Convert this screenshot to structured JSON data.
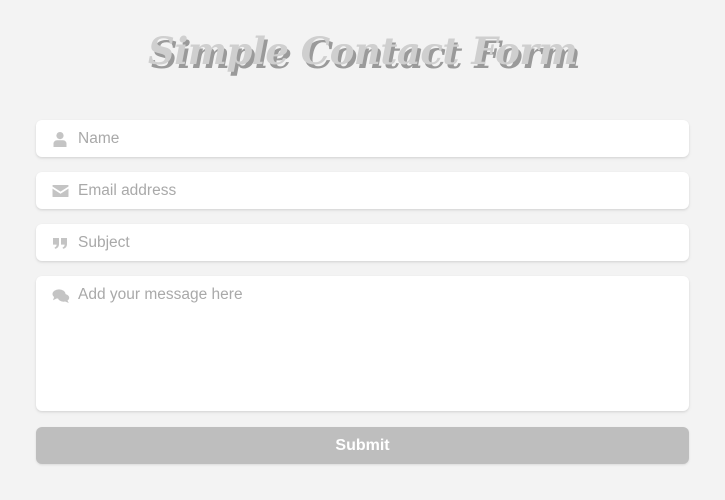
{
  "page": {
    "title": "Simple Contact Form"
  },
  "form": {
    "name": {
      "placeholder": "Name",
      "value": "",
      "icon": "user-icon"
    },
    "email": {
      "placeholder": "Email address",
      "value": "",
      "icon": "envelope-icon"
    },
    "subject": {
      "placeholder": "Subject",
      "value": "",
      "icon": "quote-icon"
    },
    "message": {
      "placeholder": "Add your message here",
      "value": "",
      "icon": "comments-icon"
    },
    "submit_label": "Submit"
  },
  "colors": {
    "background": "#f3f3f3",
    "field_background": "#ffffff",
    "icon": "#c4c4c4",
    "placeholder": "#a9a9a9",
    "button_background": "#bebebe",
    "button_text": "#ffffff",
    "title_text": "#cfcfcf",
    "title_shadow": "#9a9a9a"
  }
}
